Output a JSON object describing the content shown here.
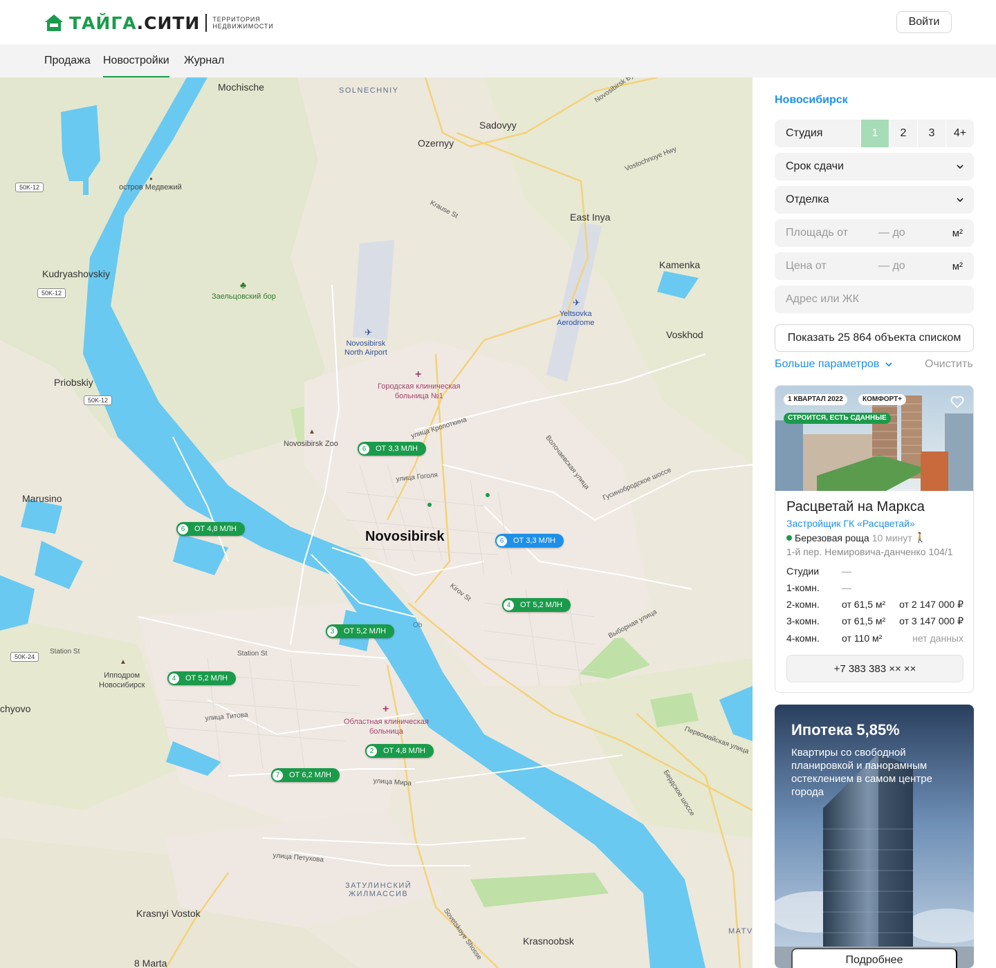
{
  "header": {
    "logo_main": "ТАЙГА",
    "logo_dot": ".",
    "logo_city": "СИТИ",
    "logo_sub_1": "ТЕРРИТОРИЯ",
    "logo_sub_2": "НЕДВИЖИМОСТИ",
    "login_label": "Войти",
    "brand_color": "#1a9b4b"
  },
  "nav": {
    "items": [
      {
        "label": "Продажа",
        "active": false
      },
      {
        "label": "Новостройки",
        "active": true
      },
      {
        "label": "Журнал",
        "active": false
      }
    ]
  },
  "map": {
    "labels": {
      "mochische": "Mochische",
      "solnechniy": "SOLNECHNIY",
      "sadovyy": "Sadovyy",
      "ozernyy": "Ozernyy",
      "bypass": "Novosibirsk Bypass N",
      "vostochnoye": "Vostochnoye Hwy",
      "ostrov": "остров Медвежий",
      "krause": "Krause St",
      "east_inya": "East Inya",
      "kamenka": "Kamenka",
      "kudryashovskiy": "Kudryashovskiy",
      "zaeltsovsky": "Заельцовский бор",
      "airport_1": "Novosibirsk",
      "airport_2": "North Airport",
      "yeltsovka_1": "Yeltsovka",
      "yeltsovka_2": "Aerodrome",
      "voskhod": "Voskhod",
      "priobskiy": "Priobskiy",
      "hospital1_1": "Городская клиническая",
      "hospital1_2": "больница №1",
      "kropotkina": "улица Кропоткина",
      "zoo": "Novosibirsk Zoo",
      "volochaevskaya": "Волочаевская улица",
      "marusino": "Marusino",
      "gogolya": "улица Гоголя",
      "gusinobrodskoe": "Гусинобродское шоссе",
      "novosibirsk": "Novosibirsk",
      "kirov": "Kirov St",
      "ob": "Ob",
      "vybornaya": "Выборная улица",
      "station_st_1": "Station St",
      "station_st_2": "Station St",
      "hippodrome_1": "Ипподром",
      "hippodrome_2": "Новосибирск",
      "chyovo": "chyovo",
      "titova": "улица Титова",
      "hospital2_1": "Областная клиническая",
      "hospital2_2": "больница",
      "pervomayskaya": "Первомайская улица",
      "berdskoe": "Бердское шоссе",
      "mira": "улица Мира",
      "petuhova": "улица Петухова",
      "zatulinsky_1": "ЗАТУЛИНСКИЙ",
      "zatulinsky_2": "ЖИЛМАССИВ",
      "krasnyi_vostok": "Krasnyi Vostok",
      "sovetskoye": "Sovetskoye Shosse",
      "krasnoobsk": "Krasnoobsk",
      "matveyev": "MATVEYEV",
      "marta": "8 Marta"
    },
    "road_badges": [
      "50K-12",
      "50K-12",
      "50K-12",
      "50K-24"
    ],
    "pins": [
      {
        "count": "6",
        "label": "ОТ 3,3 МЛН",
        "color": "green"
      },
      {
        "count": "6",
        "label": "ОТ 4,8 МЛН",
        "color": "green"
      },
      {
        "count": "6",
        "label": "ОТ 3,3 МЛН",
        "color": "blue"
      },
      {
        "count": "4",
        "label": "ОТ 5,2 МЛН",
        "color": "green"
      },
      {
        "count": "3",
        "label": "ОТ 5,2 МЛН",
        "color": "green"
      },
      {
        "count": "4",
        "label": "ОТ 5,2 МЛН",
        "color": "green"
      },
      {
        "count": "2",
        "label": "ОТ 4,8 МЛН",
        "color": "green"
      },
      {
        "count": "7",
        "label": "ОТ 6,2 МЛН",
        "color": "green"
      }
    ]
  },
  "filters": {
    "city": "Новосибирск",
    "rooms_label": "Студия",
    "room_options": [
      "1",
      "2",
      "3",
      "4+"
    ],
    "room_selected": "1",
    "deadline": "Срок сдачи",
    "finishing": "Отделка",
    "area_from": "Площадь от",
    "area_to": "— до",
    "area_unit": "м²",
    "price_from": "Цена от",
    "price_to": "— до",
    "price_unit": "м²",
    "address_placeholder": "Адрес или ЖК",
    "show_list": "Показать 25 864 объекта списком",
    "more_params": "Больше параметров",
    "clear": "Очистить"
  },
  "card": {
    "tag_quarter": "1 КВАРТАЛ 2022",
    "tag_class": "КОМФОРТ+",
    "tag_status": "СТРОИТСЯ, ЕСТЬ СДАННЫЕ",
    "title": "Расцветай на Маркса",
    "developer": "Застройщик ГК «Расцветай»",
    "metro": "Березовая роща",
    "metro_time": "10 минут",
    "address": "1-й пер. Немировича-данченко 104/1",
    "rows": [
      {
        "type": "Студии",
        "area": "—",
        "price": ""
      },
      {
        "type": "1-комн.",
        "area": "—",
        "price": ""
      },
      {
        "type": "2-комн.",
        "area": "от 61,5 м²",
        "price": "от 2 147 000 ₽"
      },
      {
        "type": "3-комн.",
        "area": "от 61,5 м²",
        "price": "от 3 147 000 ₽"
      },
      {
        "type": "4-комн.",
        "area": "от 110 м²",
        "price": "нет данных"
      }
    ],
    "phone": "+7 383 383 ×× ××"
  },
  "promo": {
    "title": "Ипотека 5,85%",
    "text": "Квартиры со свободной планировкой и панорамным остеклением в самом центре города",
    "button": "Подробнее"
  }
}
